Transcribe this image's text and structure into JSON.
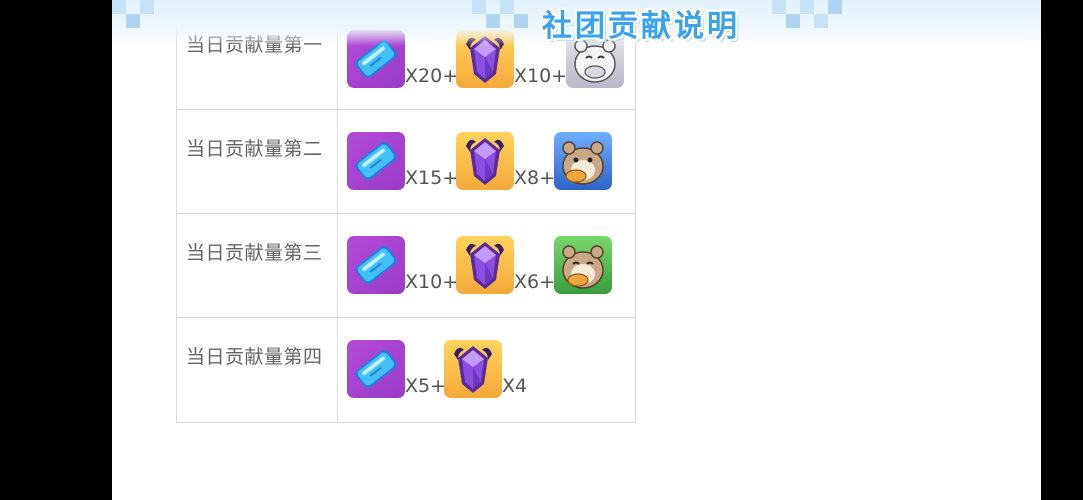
{
  "header": {
    "title": "社团贡献说明"
  },
  "rows": [
    {
      "rank": "当日贡献量第一",
      "rewards": [
        {
          "icon": "blue-card-icon",
          "count": "X20+"
        },
        {
          "icon": "purple-crystal-icon",
          "count": "X10+"
        },
        {
          "icon": "white-hamster-icon",
          "count": ""
        }
      ]
    },
    {
      "rank": "当日贡献量第二",
      "rewards": [
        {
          "icon": "blue-card-icon",
          "count": "X15+"
        },
        {
          "icon": "purple-crystal-icon",
          "count": "X8+"
        },
        {
          "icon": "blue-hamster-icon",
          "count": ""
        }
      ]
    },
    {
      "rank": "当日贡献量第三",
      "rewards": [
        {
          "icon": "blue-card-icon",
          "count": "X10+"
        },
        {
          "icon": "purple-crystal-icon",
          "count": "X6+"
        },
        {
          "icon": "green-hamster-icon",
          "count": ""
        }
      ]
    },
    {
      "rank": "当日贡献量第四",
      "rewards": [
        {
          "icon": "blue-card-icon",
          "count": "X5+"
        },
        {
          "icon": "purple-crystal-icon",
          "count": "X4"
        }
      ]
    }
  ]
}
